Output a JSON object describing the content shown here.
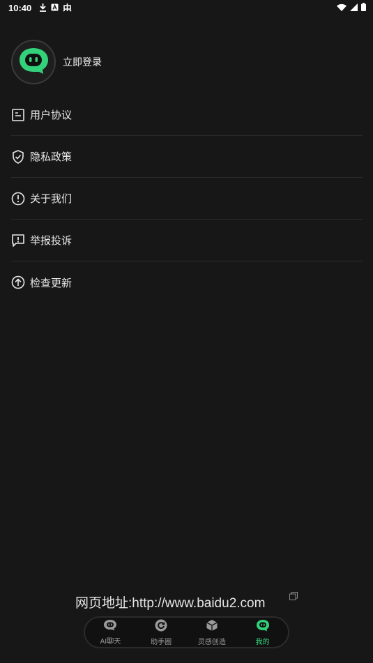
{
  "status_bar": {
    "time": "10:40"
  },
  "profile": {
    "login_label": "立即登录"
  },
  "menu": {
    "items": [
      {
        "label": "用户协议",
        "icon": "document-icon"
      },
      {
        "label": "隐私政策",
        "icon": "shield-check-icon"
      },
      {
        "label": "关于我们",
        "icon": "info-circle-icon"
      },
      {
        "label": "举报投诉",
        "icon": "report-bubble-icon"
      },
      {
        "label": "检查更新",
        "icon": "arrow-up-circle-icon"
      }
    ]
  },
  "watermark": {
    "text": "网页地址:http://www.baidu2.com"
  },
  "tabbar": {
    "tabs": [
      {
        "label": "AI聊天",
        "icon": "chat-bot-icon"
      },
      {
        "label": "助手圈",
        "icon": "circle-refresh-icon"
      },
      {
        "label": "灵感创造",
        "icon": "cube-icon"
      },
      {
        "label": "我的",
        "icon": "bot-face-icon",
        "active": true
      }
    ]
  },
  "colors": {
    "background": "#171717",
    "accent": "#33d17a"
  }
}
